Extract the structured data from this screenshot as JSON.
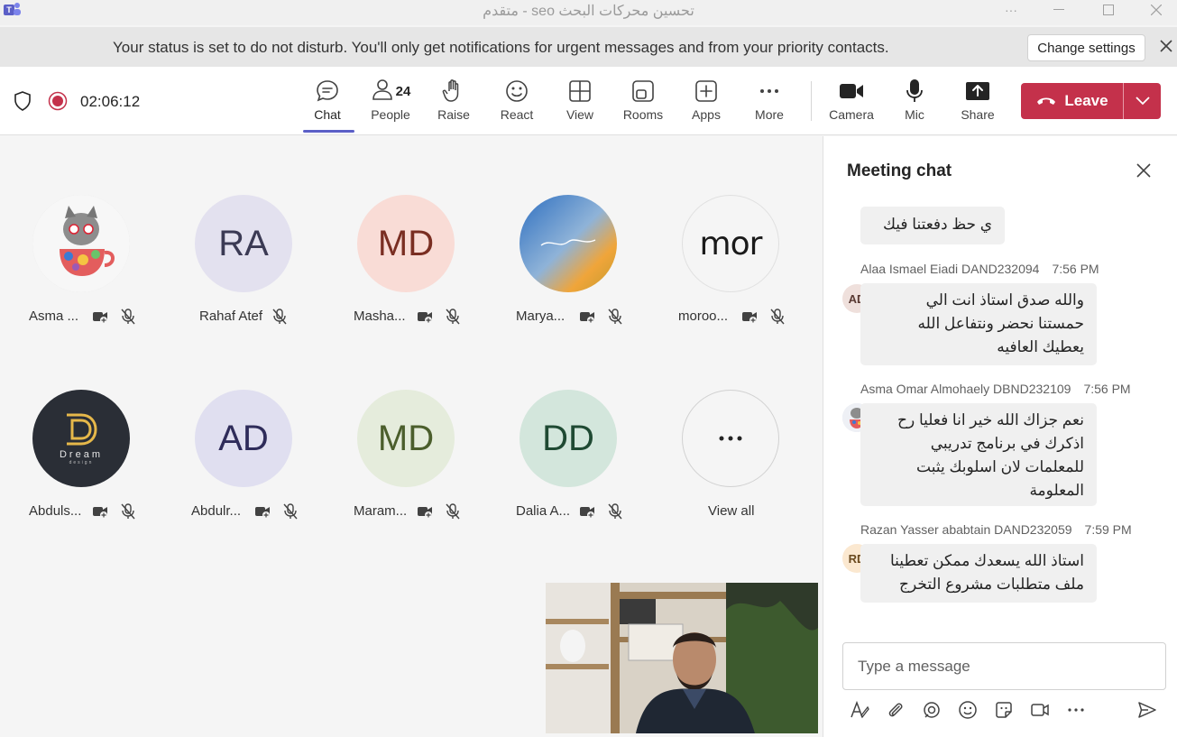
{
  "window": {
    "title": "تحسين محركات البحث seo - متقدم",
    "controls": [
      "more-options",
      "minimize",
      "maximize",
      "close"
    ]
  },
  "banner": {
    "message": "Your status is set to do not disturb. You'll only get notifications for urgent messages and from your priority contacts.",
    "button_label": "Change settings"
  },
  "toolbar": {
    "timer": "02:06:12",
    "people_count": "24",
    "items": [
      {
        "label": "Chat",
        "icon": "chat-icon"
      },
      {
        "label": "People",
        "icon": "people-icon"
      },
      {
        "label": "Raise",
        "icon": "raise-hand-icon"
      },
      {
        "label": "React",
        "icon": "react-icon"
      },
      {
        "label": "View",
        "icon": "view-icon"
      },
      {
        "label": "Rooms",
        "icon": "rooms-icon"
      },
      {
        "label": "Apps",
        "icon": "apps-icon"
      },
      {
        "label": "More",
        "icon": "more-icon"
      },
      {
        "label": "Camera",
        "icon": "camera-icon"
      },
      {
        "label": "Mic",
        "icon": "mic-icon"
      },
      {
        "label": "Share",
        "icon": "share-icon"
      }
    ],
    "leave_label": "Leave",
    "accent": "#5b5fc7",
    "leave_color": "#c4314b"
  },
  "participants": [
    {
      "name": "Asma ...",
      "initials": "",
      "bg": "#ffffff",
      "fg": "#242424"
    },
    {
      "name": "Rahaf Atef",
      "initials": "RA",
      "bg": "#e3e1ef",
      "fg": "#3b3a54"
    },
    {
      "name": "Masha...",
      "initials": "MD",
      "bg": "#f9dcd6",
      "fg": "#7a2e22"
    },
    {
      "name": "Marya...",
      "initials": "",
      "bg": "#3f6fb0",
      "fg": "#ffffff"
    },
    {
      "name": "moroo...",
      "initials": "",
      "bg": "#ffffff",
      "fg": "#1a1a1a"
    },
    {
      "name": "Abduls...",
      "initials": "",
      "bg": "#2a2e36",
      "fg": "#e6b84a"
    },
    {
      "name": "Abdulr...",
      "initials": "AD",
      "bg": "#e0dff0",
      "fg": "#2f2c5a"
    },
    {
      "name": "Maram...",
      "initials": "MD",
      "bg": "#e5ecdc",
      "fg": "#4b5e2c"
    },
    {
      "name": "Dalia A...",
      "initials": "DD",
      "bg": "#d3e6dc",
      "fg": "#1f4a33"
    },
    {
      "name": "View all",
      "initials": "...",
      "bg": "#ffffff",
      "fg": "#242424"
    }
  ],
  "logo_text": {
    "moroo": "mor",
    "dream_line1": "Dream",
    "dream_line2": "design"
  },
  "chat": {
    "title": "Meeting chat",
    "messages": [
      {
        "author": "",
        "time": "",
        "text": "ي حظ دفعتنا فيك",
        "initials": ""
      },
      {
        "author": "Alaa Ismael Eiadi DAND232094",
        "time": "7:56 PM",
        "lines": [
          "والله صدق استاذ انت الي",
          "حمستنا نحضر ونتفاعل الله",
          "يعطيك العافيه"
        ],
        "initials": "AD"
      },
      {
        "author": "Asma Omar Almohaely DBND232109",
        "time": "7:56 PM",
        "lines": [
          "نعم جزاك الله خير انا فعليا رح",
          "اذكرك في برنامج تدريبي",
          "للمعلمات لان اسلوبك يثبت",
          "المعلومة"
        ],
        "initials": ""
      },
      {
        "author": "Razan Yasser ababtain DAND232059",
        "time": "7:59 PM",
        "lines": [
          "استاذ الله يسعدك ممكن تعطينا",
          "ملف متطلبات مشروع التخرج"
        ],
        "initials": "RD"
      }
    ],
    "compose_placeholder": "Type a message"
  }
}
